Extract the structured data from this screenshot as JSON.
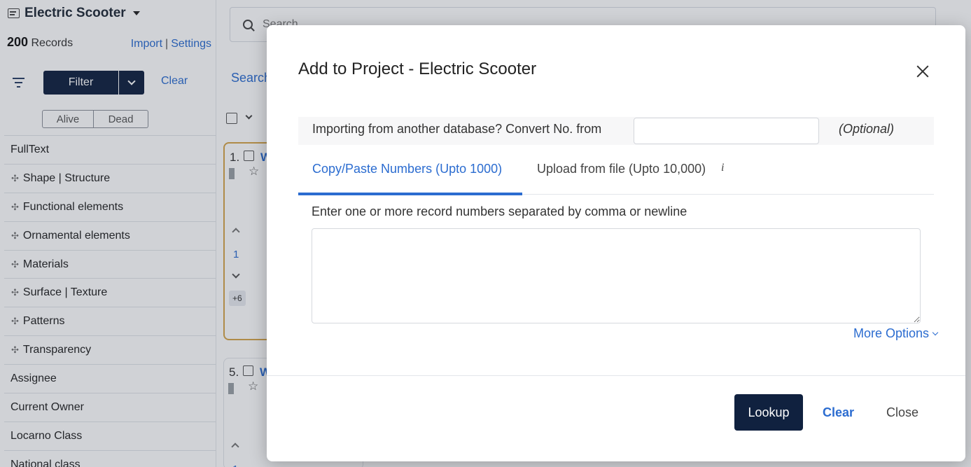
{
  "sidebar": {
    "project_name": "Electric Scooter",
    "record_count": "200",
    "records_label": "Records",
    "import_label": "Import",
    "separator": "|",
    "settings_label": "Settings",
    "filter_label": "Filter",
    "clear_label": "Clear",
    "status_toggle": [
      "Alive",
      "Dead"
    ],
    "facets": [
      {
        "label": "FullText",
        "ai": false
      },
      {
        "label": "Shape | Structure",
        "ai": true
      },
      {
        "label": "Functional elements",
        "ai": true
      },
      {
        "label": "Ornamental elements",
        "ai": true
      },
      {
        "label": "Materials",
        "ai": true
      },
      {
        "label": "Surface | Texture",
        "ai": true
      },
      {
        "label": "Patterns",
        "ai": true
      },
      {
        "label": "Transparency",
        "ai": true
      },
      {
        "label": "Assignee",
        "ai": false
      },
      {
        "label": "Current Owner",
        "ai": false
      },
      {
        "label": "Locarno Class",
        "ai": false
      },
      {
        "label": "National class",
        "ai": false
      }
    ]
  },
  "main": {
    "search_placeholder": "Search",
    "search_tab": "Search",
    "cards": [
      {
        "num": "1.",
        "link": "W",
        "count": "1",
        "more": "+6"
      },
      {
        "num": "5.",
        "link": "W",
        "count": "1"
      }
    ]
  },
  "modal": {
    "title": "Add to Project - Electric Scooter",
    "convert_label": "Importing from another database? Convert No. from",
    "convert_value": "",
    "optional_label": "(Optional)",
    "tabs": [
      "Copy/Paste Numbers (Upto 1000)",
      "Upload from file (Upto 10,000)"
    ],
    "info_icon_text": "i",
    "hint": "Enter one or more record numbers separated by comma or newline",
    "numbers_value": "",
    "more_options": "More Options",
    "lookup_label": "Lookup",
    "clear_label": "Clear",
    "close_label": "Close"
  },
  "colors": {
    "primary_dark": "#10213f",
    "link_blue": "#2b6cd0",
    "highlight_border": "#d5a54a"
  }
}
